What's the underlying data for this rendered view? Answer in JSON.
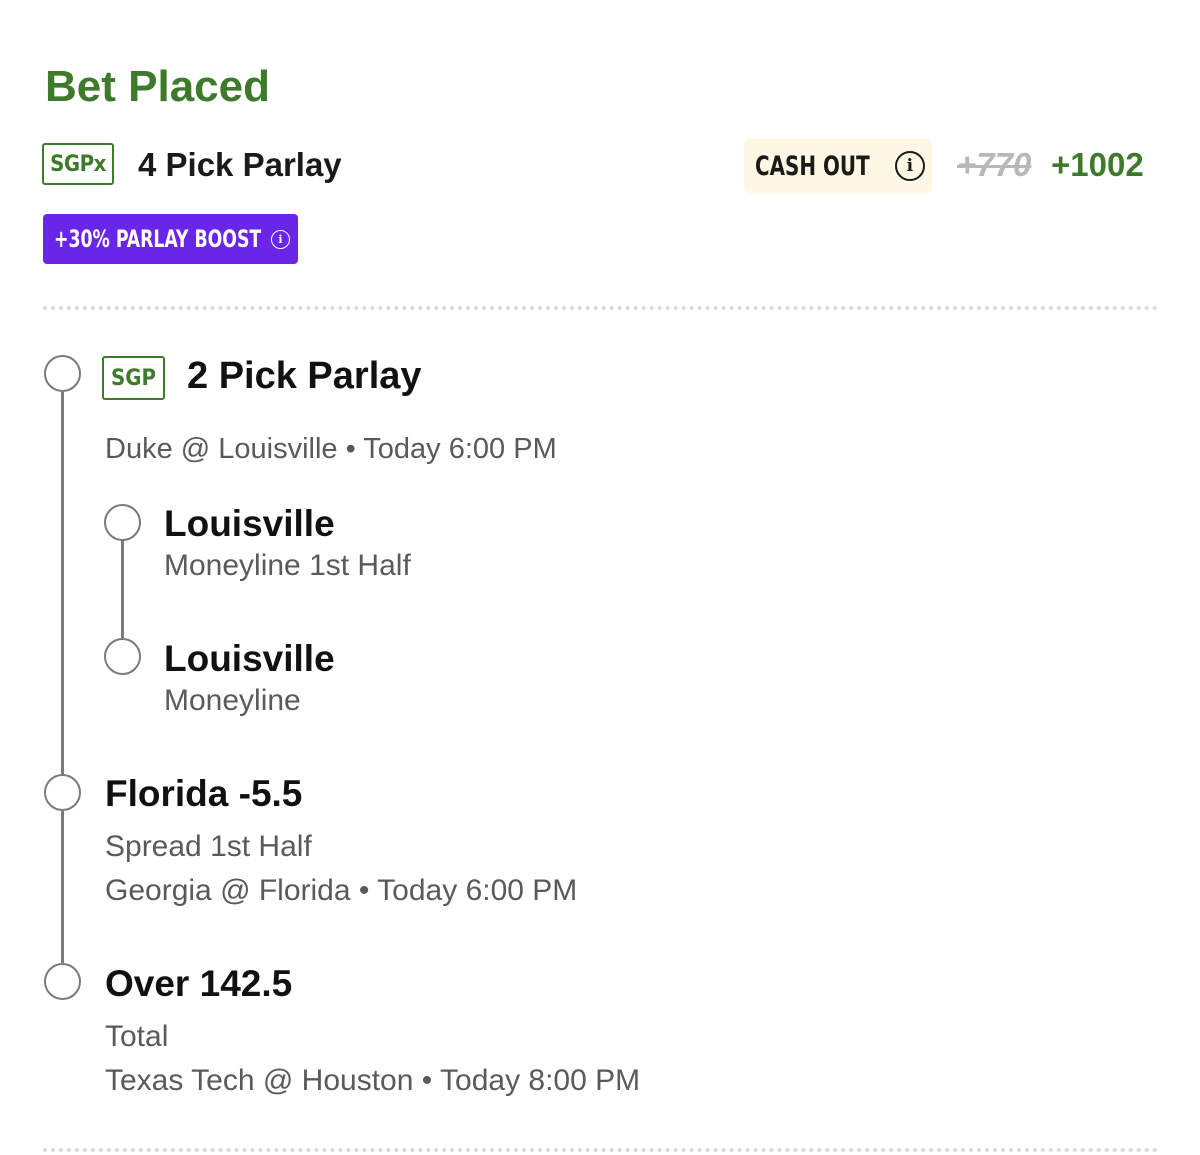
{
  "status": "Bet Placed",
  "parlay": {
    "badge": "SGPx",
    "title": "4 Pick Parlay",
    "cash_out_label": "CASH OUT",
    "old_odds": "+770",
    "new_odds": "+1002",
    "boost_label": "+30% PARLAY BOOST"
  },
  "sgp_group": {
    "badge": "SGP",
    "title": "2 Pick Parlay",
    "game": "Duke @ Louisville • Today 6:00 PM",
    "legs": [
      {
        "selection": "Louisville",
        "market": "Moneyline 1st Half"
      },
      {
        "selection": "Louisville",
        "market": "Moneyline"
      }
    ]
  },
  "legs": [
    {
      "selection": "Florida -5.5",
      "market": "Spread 1st Half",
      "game": "Georgia @ Florida • Today 6:00 PM"
    },
    {
      "selection": "Over 142.5",
      "market": "Total",
      "game": "Texas Tech @ Houston • Today 8:00 PM"
    }
  ],
  "colors": {
    "green": "#3e7a2b",
    "boost_purple": "#6a26e8",
    "cash_out_bg": "#fdf7e3"
  }
}
